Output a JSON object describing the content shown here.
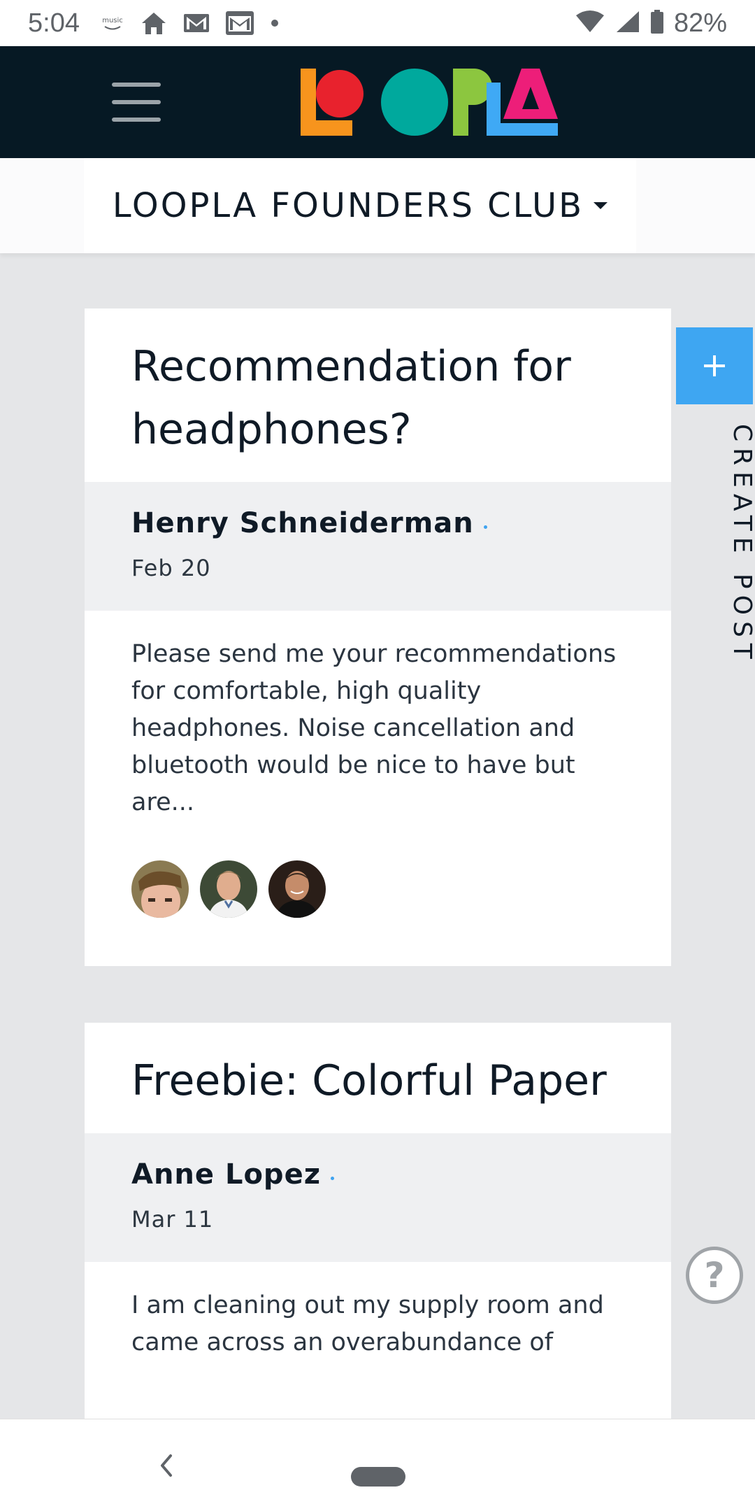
{
  "status_bar": {
    "time": "5:04",
    "music_label": "music",
    "battery_percent": "82%",
    "icons": [
      "amazon-music-icon",
      "home-icon",
      "gmail-icon",
      "gmail-icon",
      "dot-icon",
      "wifi-icon",
      "signal-icon",
      "battery-icon"
    ]
  },
  "header": {
    "logo_text": "LOOPLA",
    "logo_colors": [
      "#f7941d",
      "#e8222d",
      "#00a99d",
      "#8cc63f",
      "#3fa9f5",
      "#ed1e79"
    ],
    "menu_icon": "hamburger-menu-icon",
    "background": "#061924"
  },
  "club": {
    "name": "LOOPLA FOUNDERS CLUB"
  },
  "posts": [
    {
      "title": "Recommendation for headphones?",
      "author": "Henry Schneiderman",
      "date": "Feb 20",
      "excerpt": "Please send me your recommendations for comfortable, high quality headphones. Noise cancellation and bluetooth would be nice to have but are...",
      "participants": [
        "avatar-1",
        "avatar-2",
        "avatar-3"
      ]
    },
    {
      "title": "Freebie: Colorful Paper",
      "author": "Anne Lopez",
      "date": "Mar 11",
      "excerpt": "I am cleaning out my supply room and came across an overabundance of"
    }
  ],
  "create_post": {
    "label": "CREATE POST",
    "accent": "#3ea6f2"
  },
  "help": {
    "label": "?"
  }
}
